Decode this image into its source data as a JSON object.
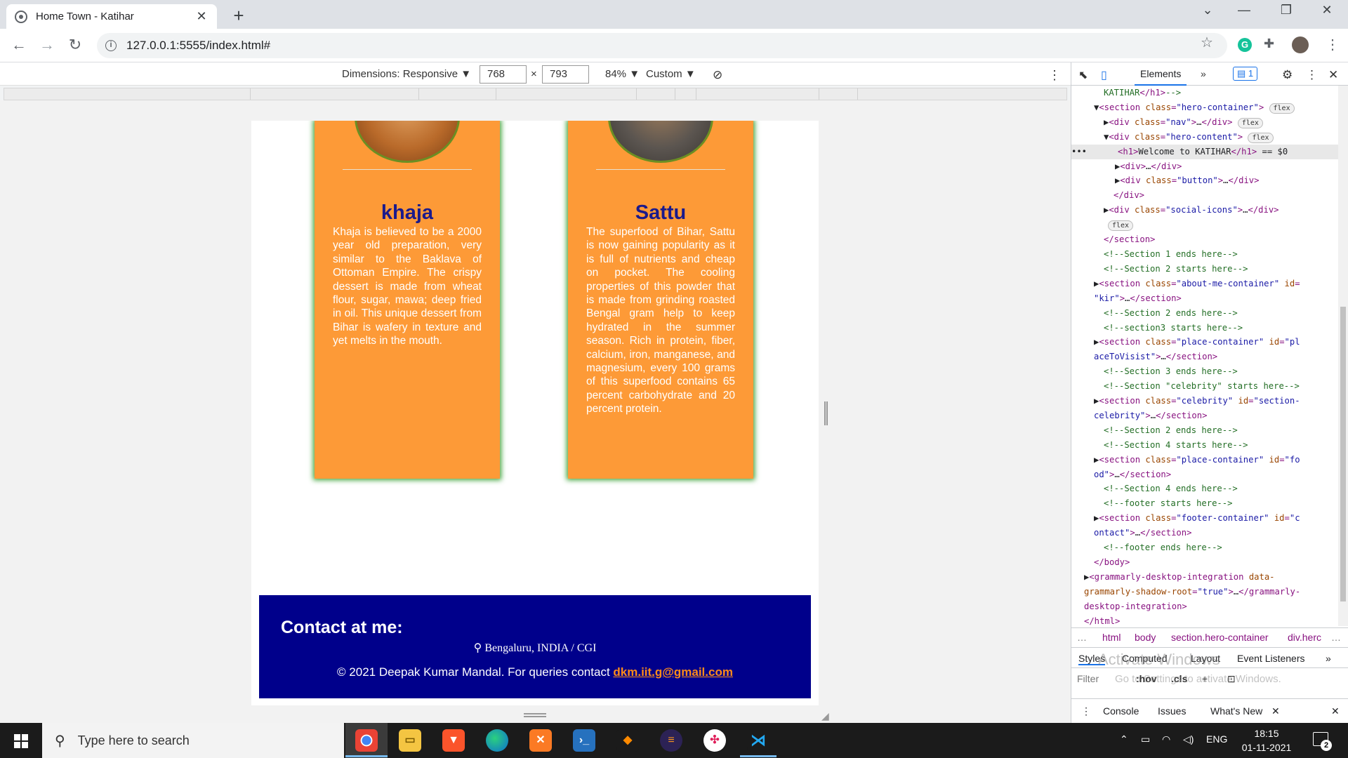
{
  "browser": {
    "tab_title": "Home Town - Katihar",
    "url": "127.0.0.1:5555/index.html#"
  },
  "device_toolbar": {
    "dimensions_label": "Dimensions: Responsive ▼",
    "width": "768",
    "times": "×",
    "height": "793",
    "zoom": "84% ▼",
    "throttle": "Custom ▼"
  },
  "page": {
    "cards": [
      {
        "title": "khaja",
        "text": "Khaja is believed to be a 2000 year old preparation, very similar to the Baklava of Ottoman Empire. The crispy dessert is made from wheat flour, sugar, mawa; deep fried in oil. This unique dessert from Bihar is wafery in texture and yet melts in the mouth."
      },
      {
        "title": "Sattu",
        "text": "The superfood of Bihar, Sattu is now gaining popularity as it is full of nutrients and cheap on pocket. The cooling properties of this powder that is made from grinding roasted Bengal gram help to keep hydrated in the summer season. Rich in protein, fiber, calcium, iron, manganese, and magnesium, every 100 grams of this superfood contains 65 percent carbohydrate and 20 percent protein."
      }
    ],
    "footer": {
      "heading": "Contact at me:",
      "location": "Bengaluru, INDIA / CGI",
      "copyright": "© 2021 Deepak Kumar Mandal. For queries contact ",
      "email": "dkm.iit.g@gmail.com"
    }
  },
  "devtools": {
    "tab_elements": "Elements",
    "more_tabs": "»",
    "issues_badge": "1",
    "breadcrumbs": [
      "html",
      "body",
      "section.hero-container",
      "div.herc"
    ],
    "subtabs": [
      "Styles",
      "Computed",
      "Layout",
      "Event Listeners"
    ],
    "filter_placeholder": "Filter",
    "filter_hov": ":hov",
    "filter_cls": ".cls",
    "drawer_tabs": [
      "Console",
      "Issues",
      "What's New"
    ],
    "watermark_1": "Activate Windows",
    "watermark_2": "Go to Settings to activate Windows."
  },
  "taskbar": {
    "search_placeholder": "Type here to search",
    "lang": "ENG",
    "time": "18:15",
    "date": "01-11-2021",
    "notifications": "2"
  }
}
